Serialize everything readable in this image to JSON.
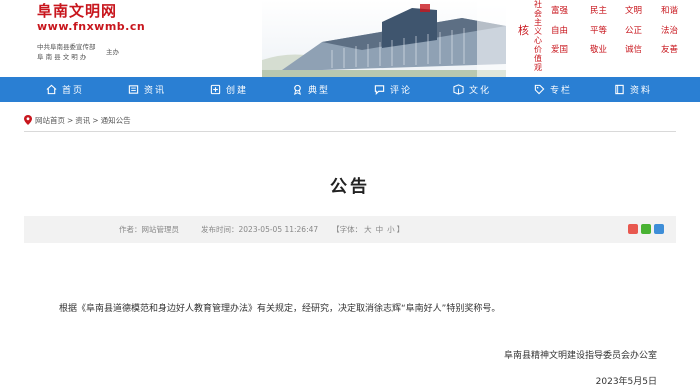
{
  "header": {
    "site_name": "阜南文明网",
    "site_url": "www.fnxwmb.cn",
    "org_line1": "中共阜南县委宣传部",
    "org_line2": "阜 南 县 文 明 办",
    "host_label": "主办",
    "values_title": "社会主义核心价值观",
    "values_big": "核",
    "values_col": "社会主义心价值观",
    "core_values": [
      "富强",
      "民主",
      "文明",
      "和谐",
      "自由",
      "平等",
      "公正",
      "法治",
      "爱国",
      "敬业",
      "诚信",
      "友善"
    ]
  },
  "nav": {
    "bg_color": "#2a7fd3",
    "items": [
      {
        "label": "首页",
        "icon": "home-icon"
      },
      {
        "label": "资讯",
        "icon": "news-icon"
      },
      {
        "label": "创建",
        "icon": "create-icon"
      },
      {
        "label": "典型",
        "icon": "award-icon"
      },
      {
        "label": "评论",
        "icon": "comment-icon"
      },
      {
        "label": "文化",
        "icon": "culture-icon"
      },
      {
        "label": "专栏",
        "icon": "tag-icon"
      },
      {
        "label": "资料",
        "icon": "book-icon"
      }
    ]
  },
  "breadcrumb": {
    "items": [
      "网站首页",
      "资讯",
      "通知公告"
    ],
    "separator": ">"
  },
  "article": {
    "title": "公告",
    "author": "作者：网站管理员",
    "published": "发布时间：2023-05-05 11:26:47",
    "font_label_open": "【字体：",
    "font_large": "大",
    "font_medium": "中",
    "font_small": "小",
    "font_label_close": "】",
    "body": "根据《阜南县道德模范和身边好人教育管理办法》有关规定，经研究，决定取消徐志辉“阜南好人”特别奖称号。",
    "signature": "阜南县精神文明建设指导委员会办公室",
    "date": "2023年5月5日"
  }
}
